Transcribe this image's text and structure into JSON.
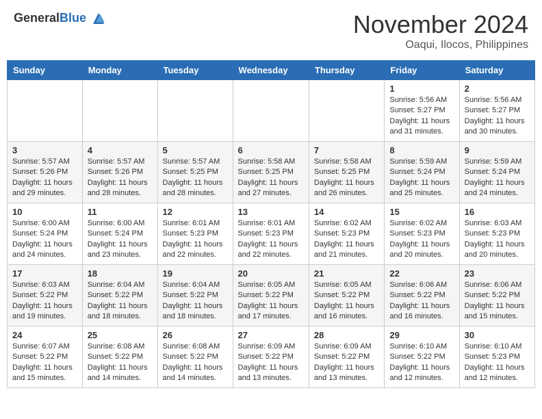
{
  "header": {
    "logo_general": "General",
    "logo_blue": "Blue",
    "month_title": "November 2024",
    "location": "Oaqui, Ilocos, Philippines"
  },
  "weekdays": [
    "Sunday",
    "Monday",
    "Tuesday",
    "Wednesday",
    "Thursday",
    "Friday",
    "Saturday"
  ],
  "weeks": [
    [
      {
        "day": "",
        "info": ""
      },
      {
        "day": "",
        "info": ""
      },
      {
        "day": "",
        "info": ""
      },
      {
        "day": "",
        "info": ""
      },
      {
        "day": "",
        "info": ""
      },
      {
        "day": "1",
        "info": "Sunrise: 5:56 AM\nSunset: 5:27 PM\nDaylight: 11 hours and 31 minutes."
      },
      {
        "day": "2",
        "info": "Sunrise: 5:56 AM\nSunset: 5:27 PM\nDaylight: 11 hours and 30 minutes."
      }
    ],
    [
      {
        "day": "3",
        "info": "Sunrise: 5:57 AM\nSunset: 5:26 PM\nDaylight: 11 hours and 29 minutes."
      },
      {
        "day": "4",
        "info": "Sunrise: 5:57 AM\nSunset: 5:26 PM\nDaylight: 11 hours and 28 minutes."
      },
      {
        "day": "5",
        "info": "Sunrise: 5:57 AM\nSunset: 5:25 PM\nDaylight: 11 hours and 28 minutes."
      },
      {
        "day": "6",
        "info": "Sunrise: 5:58 AM\nSunset: 5:25 PM\nDaylight: 11 hours and 27 minutes."
      },
      {
        "day": "7",
        "info": "Sunrise: 5:58 AM\nSunset: 5:25 PM\nDaylight: 11 hours and 26 minutes."
      },
      {
        "day": "8",
        "info": "Sunrise: 5:59 AM\nSunset: 5:24 PM\nDaylight: 11 hours and 25 minutes."
      },
      {
        "day": "9",
        "info": "Sunrise: 5:59 AM\nSunset: 5:24 PM\nDaylight: 11 hours and 24 minutes."
      }
    ],
    [
      {
        "day": "10",
        "info": "Sunrise: 6:00 AM\nSunset: 5:24 PM\nDaylight: 11 hours and 24 minutes."
      },
      {
        "day": "11",
        "info": "Sunrise: 6:00 AM\nSunset: 5:24 PM\nDaylight: 11 hours and 23 minutes."
      },
      {
        "day": "12",
        "info": "Sunrise: 6:01 AM\nSunset: 5:23 PM\nDaylight: 11 hours and 22 minutes."
      },
      {
        "day": "13",
        "info": "Sunrise: 6:01 AM\nSunset: 5:23 PM\nDaylight: 11 hours and 22 minutes."
      },
      {
        "day": "14",
        "info": "Sunrise: 6:02 AM\nSunset: 5:23 PM\nDaylight: 11 hours and 21 minutes."
      },
      {
        "day": "15",
        "info": "Sunrise: 6:02 AM\nSunset: 5:23 PM\nDaylight: 11 hours and 20 minutes."
      },
      {
        "day": "16",
        "info": "Sunrise: 6:03 AM\nSunset: 5:23 PM\nDaylight: 11 hours and 20 minutes."
      }
    ],
    [
      {
        "day": "17",
        "info": "Sunrise: 6:03 AM\nSunset: 5:22 PM\nDaylight: 11 hours and 19 minutes."
      },
      {
        "day": "18",
        "info": "Sunrise: 6:04 AM\nSunset: 5:22 PM\nDaylight: 11 hours and 18 minutes."
      },
      {
        "day": "19",
        "info": "Sunrise: 6:04 AM\nSunset: 5:22 PM\nDaylight: 11 hours and 18 minutes."
      },
      {
        "day": "20",
        "info": "Sunrise: 6:05 AM\nSunset: 5:22 PM\nDaylight: 11 hours and 17 minutes."
      },
      {
        "day": "21",
        "info": "Sunrise: 6:05 AM\nSunset: 5:22 PM\nDaylight: 11 hours and 16 minutes."
      },
      {
        "day": "22",
        "info": "Sunrise: 6:06 AM\nSunset: 5:22 PM\nDaylight: 11 hours and 16 minutes."
      },
      {
        "day": "23",
        "info": "Sunrise: 6:06 AM\nSunset: 5:22 PM\nDaylight: 11 hours and 15 minutes."
      }
    ],
    [
      {
        "day": "24",
        "info": "Sunrise: 6:07 AM\nSunset: 5:22 PM\nDaylight: 11 hours and 15 minutes."
      },
      {
        "day": "25",
        "info": "Sunrise: 6:08 AM\nSunset: 5:22 PM\nDaylight: 11 hours and 14 minutes."
      },
      {
        "day": "26",
        "info": "Sunrise: 6:08 AM\nSunset: 5:22 PM\nDaylight: 11 hours and 14 minutes."
      },
      {
        "day": "27",
        "info": "Sunrise: 6:09 AM\nSunset: 5:22 PM\nDaylight: 11 hours and 13 minutes."
      },
      {
        "day": "28",
        "info": "Sunrise: 6:09 AM\nSunset: 5:22 PM\nDaylight: 11 hours and 13 minutes."
      },
      {
        "day": "29",
        "info": "Sunrise: 6:10 AM\nSunset: 5:22 PM\nDaylight: 11 hours and 12 minutes."
      },
      {
        "day": "30",
        "info": "Sunrise: 6:10 AM\nSunset: 5:23 PM\nDaylight: 11 hours and 12 minutes."
      }
    ]
  ]
}
